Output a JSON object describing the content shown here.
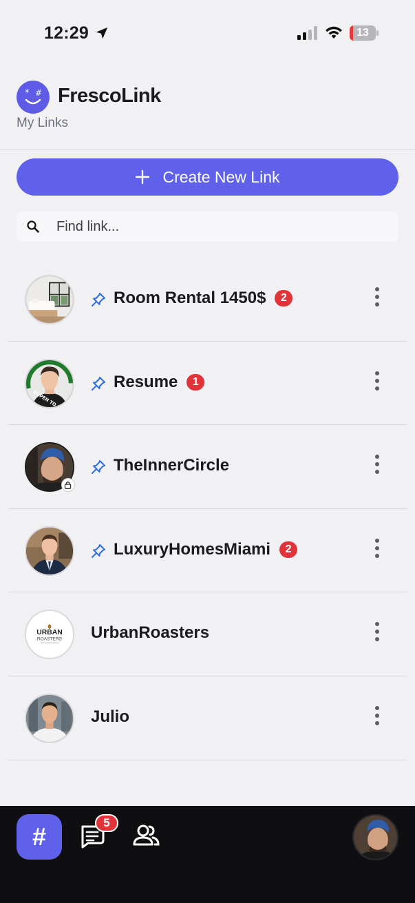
{
  "status_bar": {
    "time": "12:29",
    "battery_level": "13",
    "battery_fraction": 0.13,
    "icons": [
      "location-arrow-icon",
      "cellular-signal-icon",
      "wifi-icon",
      "battery-icon"
    ]
  },
  "header": {
    "app_name": "FrescoLink",
    "subtitle": "My Links",
    "logo_icon": "smiley-logo-icon"
  },
  "actions": {
    "create_label": "Create New Link",
    "create_icon": "plus-icon"
  },
  "search": {
    "placeholder": "Find link...",
    "value": "",
    "icon": "search-icon"
  },
  "links": [
    {
      "title": "Room Rental 1450$",
      "pinned": true,
      "badge": "2",
      "avatar": "bedroom-photo",
      "locked": false
    },
    {
      "title": "Resume",
      "pinned": true,
      "badge": "1",
      "avatar": "man-portrait-open-to-followers",
      "avatar_caption": "#OPEN TO FOLLOWERS",
      "locked": false
    },
    {
      "title": "TheInnerCircle",
      "pinned": true,
      "badge": null,
      "avatar": "man-selfie-blue-cap",
      "locked": true
    },
    {
      "title": "LuxuryHomesMiami",
      "pinned": true,
      "badge": "2",
      "avatar": "man-in-suit-portrait",
      "locked": false
    },
    {
      "title": "UrbanRoasters",
      "pinned": false,
      "badge": null,
      "avatar": "urban-roasters-logo",
      "logo_text_1": "URBAN",
      "logo_text_2": "ROASTERS",
      "locked": false
    },
    {
      "title": "Julio",
      "pinned": false,
      "badge": null,
      "avatar": "man-portrait-outdoor",
      "locked": false
    }
  ],
  "tab_bar": {
    "hash_label": "#",
    "chat_badge": "5",
    "icons": [
      "hash-tab-icon",
      "chat-tab-icon",
      "people-tab-icon",
      "profile-avatar"
    ]
  },
  "colors": {
    "accent": "#6061ea",
    "badge": "#e0343a",
    "background": "#f1f1f4",
    "tab_bar": "#0f0f11",
    "pin": "#2f6fdc"
  }
}
